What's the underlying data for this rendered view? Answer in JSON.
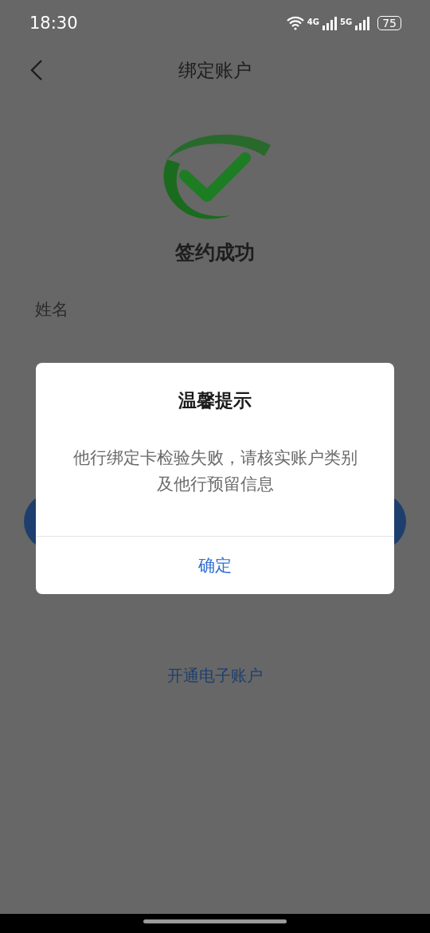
{
  "status_bar": {
    "time": "18:30",
    "network_1": "4G",
    "network_2": "5G",
    "battery": "75"
  },
  "nav": {
    "title": "绑定账户"
  },
  "result": {
    "title": "签约成功"
  },
  "fields": [
    {
      "label": "姓名"
    }
  ],
  "link": "开通电子账户",
  "dialog": {
    "title": "温馨提示",
    "message": "他行绑定卡检验失败，请核实账户类别及他行预留信息",
    "button": "确定"
  }
}
